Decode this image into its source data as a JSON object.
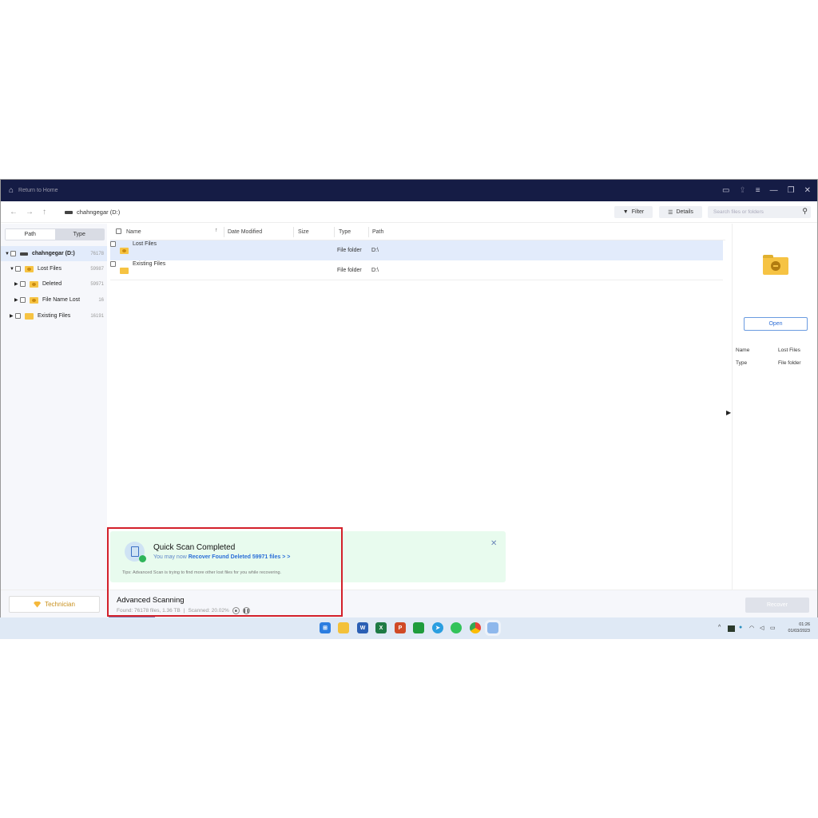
{
  "titlebar": {
    "return_home": "Return to Home",
    "buttons": [
      "feedback-icon",
      "share-icon",
      "menu-icon",
      "minimize-icon",
      "restore-icon",
      "close-icon"
    ]
  },
  "toolbar": {
    "drive": "chahngegar (D:)",
    "filter": "Filter",
    "details": "Details",
    "search_placeholder": "Search files or folders"
  },
  "sidebar": {
    "tabs": [
      "Path",
      "Type"
    ],
    "active_tab": "Path",
    "tree": [
      {
        "label": "chahngegar (D:)",
        "count": "76178"
      },
      {
        "label": "Lost Files",
        "count": "59987"
      },
      {
        "label": "Deleted",
        "count": "59971"
      },
      {
        "label": "File Name Lost",
        "count": "16"
      },
      {
        "label": "Existing Files",
        "count": "16191"
      }
    ],
    "technician": "Technician"
  },
  "table": {
    "columns": [
      "Name",
      "Date Modified",
      "Size",
      "Type",
      "Path"
    ],
    "rows": [
      {
        "name": "Lost Files",
        "date": "",
        "size": "",
        "type": "File folder",
        "path": "D:\\",
        "selected": true
      },
      {
        "name": "Existing Files",
        "date": "",
        "size": "",
        "type": "File folder",
        "path": "D:\\",
        "selected": false
      }
    ]
  },
  "preview": {
    "open": "Open",
    "name_label": "Name",
    "name_value": "Lost Files",
    "type_label": "Type",
    "type_value": "File folder"
  },
  "notice": {
    "title": "Quick Scan Completed",
    "sub_prefix": "You may now",
    "sub_link": "Recover Found Deleted 59971 files > >",
    "tip": "Tips: Advanced Scan is trying to find more other lost files for you while recovering."
  },
  "scan": {
    "title": "Advanced Scanning",
    "found": "Found: 76178 files, 1.36 TB",
    "scanned": "Scanned: 20.02%",
    "progress_percent": 20.02
  },
  "recover": "Recover",
  "taskbar": {
    "apps": [
      "windows-start",
      "file-explorer",
      "word",
      "excel",
      "powerpoint",
      "evernote",
      "telegram",
      "whatsapp",
      "chrome",
      "recovery-app"
    ],
    "time": "01:26",
    "date": "01/03/2023"
  },
  "colors": {
    "titlebar": "#151c45",
    "accent": "#2a6ed8",
    "notice_bg": "#e8fbee",
    "highlight": "#d3202a"
  }
}
